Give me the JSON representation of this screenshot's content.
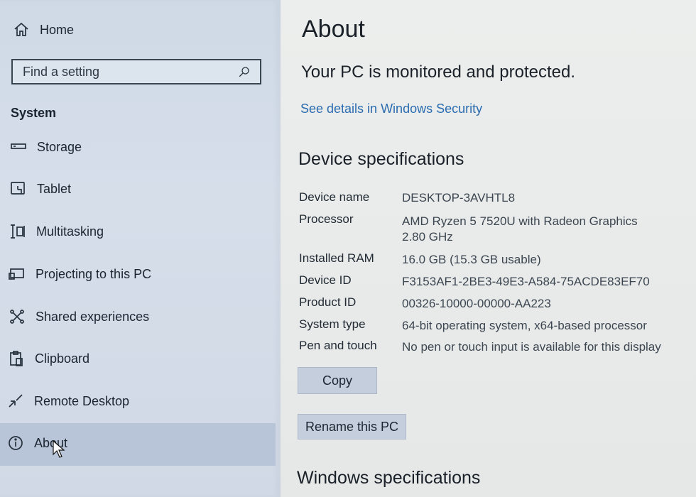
{
  "sidebar": {
    "home_label": "Home",
    "search_placeholder": "Find a setting",
    "section_title": "System",
    "items": [
      {
        "label": "Storage",
        "icon": "storage-icon"
      },
      {
        "label": "Tablet",
        "icon": "tablet-icon"
      },
      {
        "label": "Multitasking",
        "icon": "multitasking-icon"
      },
      {
        "label": "Projecting to this PC",
        "icon": "projecting-icon"
      },
      {
        "label": "Shared experiences",
        "icon": "shared-experiences-icon"
      },
      {
        "label": "Clipboard",
        "icon": "clipboard-icon"
      },
      {
        "label": "Remote Desktop",
        "icon": "remote-desktop-icon"
      },
      {
        "label": "About",
        "icon": "info-icon",
        "selected": true
      }
    ]
  },
  "main": {
    "title": "About",
    "status": "Your PC is monitored and protected.",
    "security_link": "See details in Windows Security",
    "device_specs_heading": "Device specifications",
    "specs": [
      {
        "label": "Device name",
        "value": "DESKTOP-3AVHTL8"
      },
      {
        "label": "Processor",
        "value": "AMD Ryzen 5 7520U with Radeon Graphics",
        "value2": "2.80 GHz"
      },
      {
        "label": "Installed RAM",
        "value": "16.0 GB (15.3 GB usable)"
      },
      {
        "label": "Device ID",
        "value": "F3153AF1-2BE3-49E3-A584-75ACDE83EF70"
      },
      {
        "label": "Product ID",
        "value": "00326-10000-00000-AA223"
      },
      {
        "label": "System type",
        "value": "64-bit operating system, x64-based processor"
      },
      {
        "label": "Pen and touch",
        "value": "No pen or touch input is available for this display"
      }
    ],
    "copy_button": "Copy",
    "rename_button": "Rename this PC",
    "windows_specs_heading": "Windows specifications"
  },
  "colors": {
    "sidebar_bg": "#d1d9e6",
    "selected_bg": "#b8c4d7",
    "main_bg": "#e8eaea",
    "link": "#2b6cb0",
    "button_bg": "#c4cedd"
  }
}
